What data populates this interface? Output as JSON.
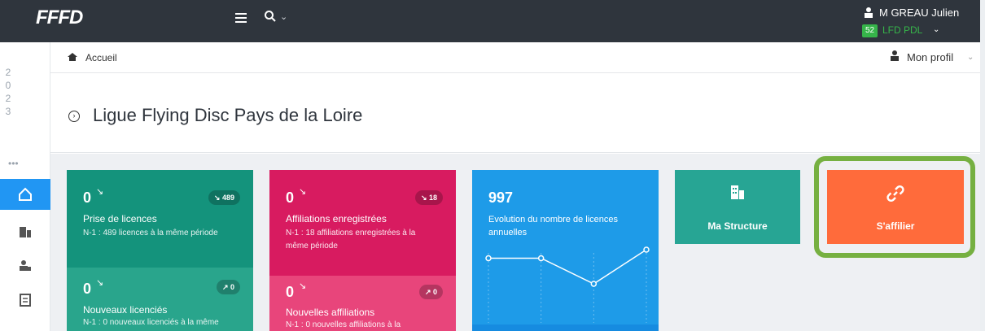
{
  "brand": {
    "logo_text": "FFFD"
  },
  "topbar": {
    "user_name": "M GREAU Julien",
    "org_badge": "52",
    "org_name": "LFD PDL"
  },
  "sidebar": {
    "year_digits": [
      "2",
      "0",
      "2",
      "3"
    ],
    "more": "•••",
    "nav_items": [
      {
        "icon": "home-icon",
        "active": true
      },
      {
        "icon": "building-icon",
        "active": false
      },
      {
        "icon": "users-icon",
        "active": false
      },
      {
        "icon": "document-icon",
        "active": false
      }
    ]
  },
  "breadcrumb": {
    "home": "Accueil",
    "profile": "Mon profil"
  },
  "page": {
    "title": "Ligue Flying Disc Pays de la Loire"
  },
  "cards": {
    "licences": {
      "value": "0",
      "badge": "489",
      "label": "Prise de licences",
      "sub": "N-1 : 489 licences à la même période"
    },
    "new_licencees": {
      "value": "0",
      "badge": "0",
      "label": "Nouveaux licenciés",
      "sub": "N-1 : 0 nouveaux licenciés à la même"
    },
    "affiliations": {
      "value": "0",
      "badge": "18",
      "label": "Affiliations enregistrées",
      "sub1": "N-1 : 18 affiliations enregistrées à la",
      "sub2": "même période"
    },
    "new_affiliations": {
      "value": "0",
      "badge": "0",
      "label": "Nouvelles affiliations",
      "sub": "N-1 : 0 nouvelles affiliations à la"
    },
    "evolution": {
      "value": "997",
      "label1": "Evolution du nombre de licences",
      "label2": "annuelles"
    },
    "structure": {
      "label": "Ma Structure"
    },
    "affilier": {
      "label": "S'affilier"
    }
  },
  "colors": {
    "accent": "#2196f3",
    "highlight": "#76b041"
  },
  "chart_data": {
    "type": "line",
    "x": [
      "",
      "",
      "",
      ""
    ],
    "values": [
      4,
      4,
      1,
      5
    ],
    "title": "",
    "xlabel": "",
    "ylabel": ""
  }
}
